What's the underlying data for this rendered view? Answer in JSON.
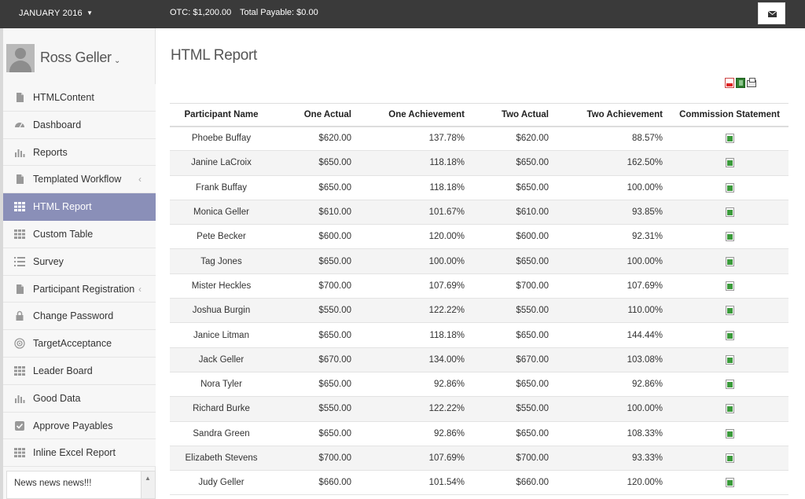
{
  "topbar": {
    "period": "JANUARY 2016",
    "otc": "OTC: $1,200.00",
    "total_payable": "Total Payable: $0.00",
    "mail_icon": "envelope-icon"
  },
  "user": {
    "name": "Ross Geller"
  },
  "sidebar": {
    "items": [
      {
        "label": "HTMLContent",
        "icon": "file-icon"
      },
      {
        "label": "Dashboard",
        "icon": "dashboard-icon"
      },
      {
        "label": "Reports",
        "icon": "bar-chart-icon"
      },
      {
        "label": "Templated Workflow",
        "icon": "file-icon",
        "caret": "‹"
      },
      {
        "label": "HTML Report",
        "icon": "grid-icon",
        "active": true
      },
      {
        "label": "Custom Table",
        "icon": "grid-icon"
      },
      {
        "label": "Survey",
        "icon": "list-icon"
      },
      {
        "label": "Participant Registration",
        "icon": "file-icon",
        "caret": "‹"
      },
      {
        "label": "Change Password",
        "icon": "lock-icon"
      },
      {
        "label": "TargetAcceptance",
        "icon": "target-icon"
      },
      {
        "label": "Leader Board",
        "icon": "grid-icon"
      },
      {
        "label": "Good Data",
        "icon": "bar-chart-icon"
      },
      {
        "label": "Approve Payables",
        "icon": "check-square-icon"
      },
      {
        "label": "Inline Excel Report",
        "icon": "grid-icon"
      }
    ],
    "news": "News news news!!!"
  },
  "main": {
    "title": "HTML Report",
    "export_icons": [
      "pdf-icon",
      "excel-icon",
      "print-icon"
    ],
    "table": {
      "headers": [
        "Participant Name",
        "One Actual",
        "One Achievement",
        "Two Actual",
        "Two Achievement",
        "Commission Statement"
      ],
      "rows": [
        [
          "Phoebe Buffay",
          "$620.00",
          "137.78%",
          "$620.00",
          "88.57%"
        ],
        [
          "Janine LaCroix",
          "$650.00",
          "118.18%",
          "$650.00",
          "162.50%"
        ],
        [
          "Frank Buffay",
          "$650.00",
          "118.18%",
          "$650.00",
          "100.00%"
        ],
        [
          "Monica Geller",
          "$610.00",
          "101.67%",
          "$610.00",
          "93.85%"
        ],
        [
          "Pete Becker",
          "$600.00",
          "120.00%",
          "$600.00",
          "92.31%"
        ],
        [
          "Tag Jones",
          "$650.00",
          "100.00%",
          "$650.00",
          "100.00%"
        ],
        [
          "Mister Heckles",
          "$700.00",
          "107.69%",
          "$700.00",
          "107.69%"
        ],
        [
          "Joshua Burgin",
          "$550.00",
          "122.22%",
          "$550.00",
          "110.00%"
        ],
        [
          "Janice Litman",
          "$650.00",
          "118.18%",
          "$650.00",
          "144.44%"
        ],
        [
          "Jack Geller",
          "$670.00",
          "134.00%",
          "$670.00",
          "103.08%"
        ],
        [
          "Nora Tyler",
          "$650.00",
          "92.86%",
          "$650.00",
          "92.86%"
        ],
        [
          "Richard Burke",
          "$550.00",
          "122.22%",
          "$550.00",
          "100.00%"
        ],
        [
          "Sandra Green",
          "$650.00",
          "92.86%",
          "$650.00",
          "108.33%"
        ],
        [
          "Elizabeth Stevens",
          "$700.00",
          "107.69%",
          "$700.00",
          "93.33%"
        ],
        [
          "Judy Geller",
          "$660.00",
          "101.54%",
          "$660.00",
          "120.00%"
        ]
      ],
      "row_icon": "excel-file-icon"
    }
  },
  "colors": {
    "topbar_bg": "#3a3a3a",
    "active_menu_bg": "#8a8fb8",
    "sidebar_bg": "#f7f7f7",
    "excel_green": "#3c9b3c"
  }
}
